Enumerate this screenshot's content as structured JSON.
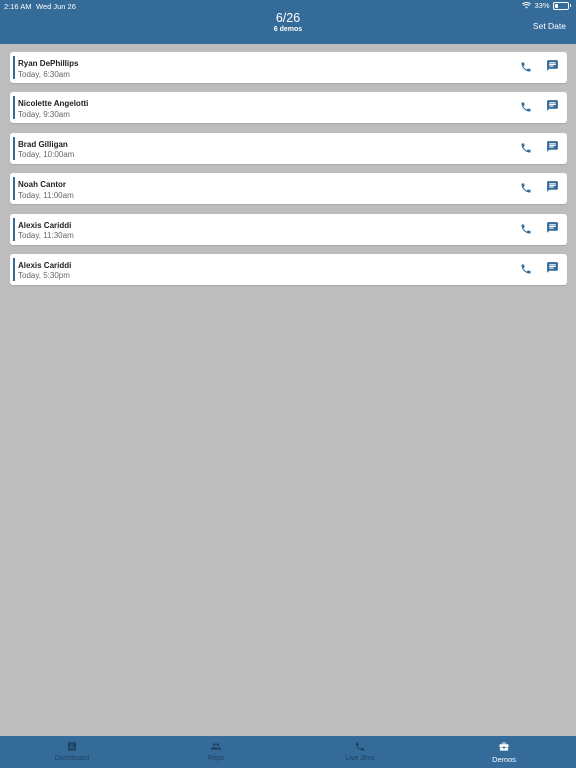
{
  "status_bar": {
    "time": "2:16 AM",
    "date": "Wed Jun 26",
    "battery": "33%",
    "battery_level": 0.33
  },
  "header": {
    "title": "6/26",
    "subtitle": "6 demos",
    "set_date_label": "Set Date"
  },
  "demos": [
    {
      "name": "Ryan DePhillips",
      "time": "Today, 6:30am"
    },
    {
      "name": "Nicolette Angelotti",
      "time": "Today, 9:30am"
    },
    {
      "name": "Brad Gilligan",
      "time": "Today, 10:00am"
    },
    {
      "name": "Noah Cantor",
      "time": "Today, 11:00am"
    },
    {
      "name": "Alexis Cariddi",
      "time": "Today, 11:30am"
    },
    {
      "name": "Alexis Cariddi",
      "time": "Today, 5:30pm"
    }
  ],
  "tabs": [
    {
      "label": "Dashboard",
      "icon": "bar-chart-icon"
    },
    {
      "label": "Reps",
      "icon": "people-icon"
    },
    {
      "label": "Live Jims",
      "icon": "phone-icon"
    },
    {
      "label": "Demos",
      "icon": "briefcase-icon",
      "active": true
    }
  ],
  "colors": {
    "primary": "#346b99",
    "background": "#bdbdbd",
    "inactive_tab": "#1e4164"
  }
}
